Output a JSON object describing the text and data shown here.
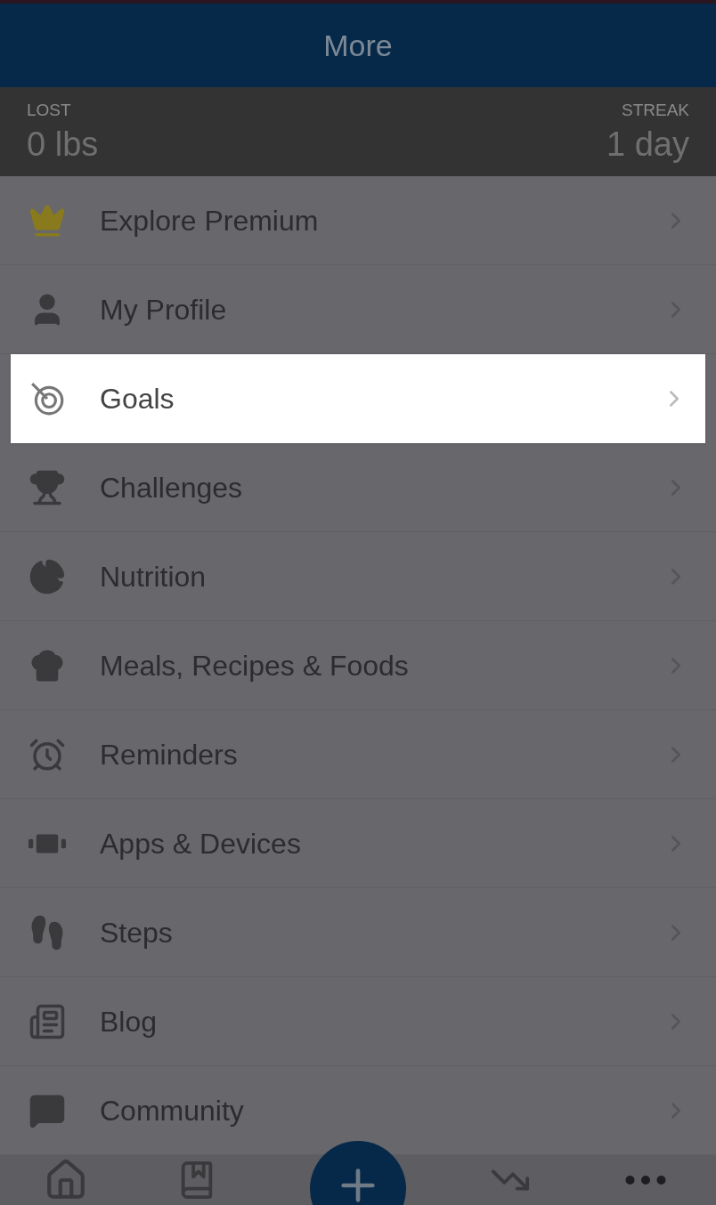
{
  "header": {
    "title": "More"
  },
  "stats": {
    "lost": {
      "label": "LOST",
      "value": "0 lbs"
    },
    "streak": {
      "label": "STREAK",
      "value": "1 day"
    }
  },
  "menu": [
    {
      "label": "Explore Premium",
      "highlighted": false
    },
    {
      "label": "My Profile",
      "highlighted": false
    },
    {
      "label": "Goals",
      "highlighted": true
    },
    {
      "label": "Challenges",
      "highlighted": false
    },
    {
      "label": "Nutrition",
      "highlighted": false
    },
    {
      "label": "Meals, Recipes & Foods",
      "highlighted": false
    },
    {
      "label": "Reminders",
      "highlighted": false
    },
    {
      "label": "Apps & Devices",
      "highlighted": false
    },
    {
      "label": "Steps",
      "highlighted": false
    },
    {
      "label": "Blog",
      "highlighted": false
    },
    {
      "label": "Community",
      "highlighted": false
    }
  ]
}
